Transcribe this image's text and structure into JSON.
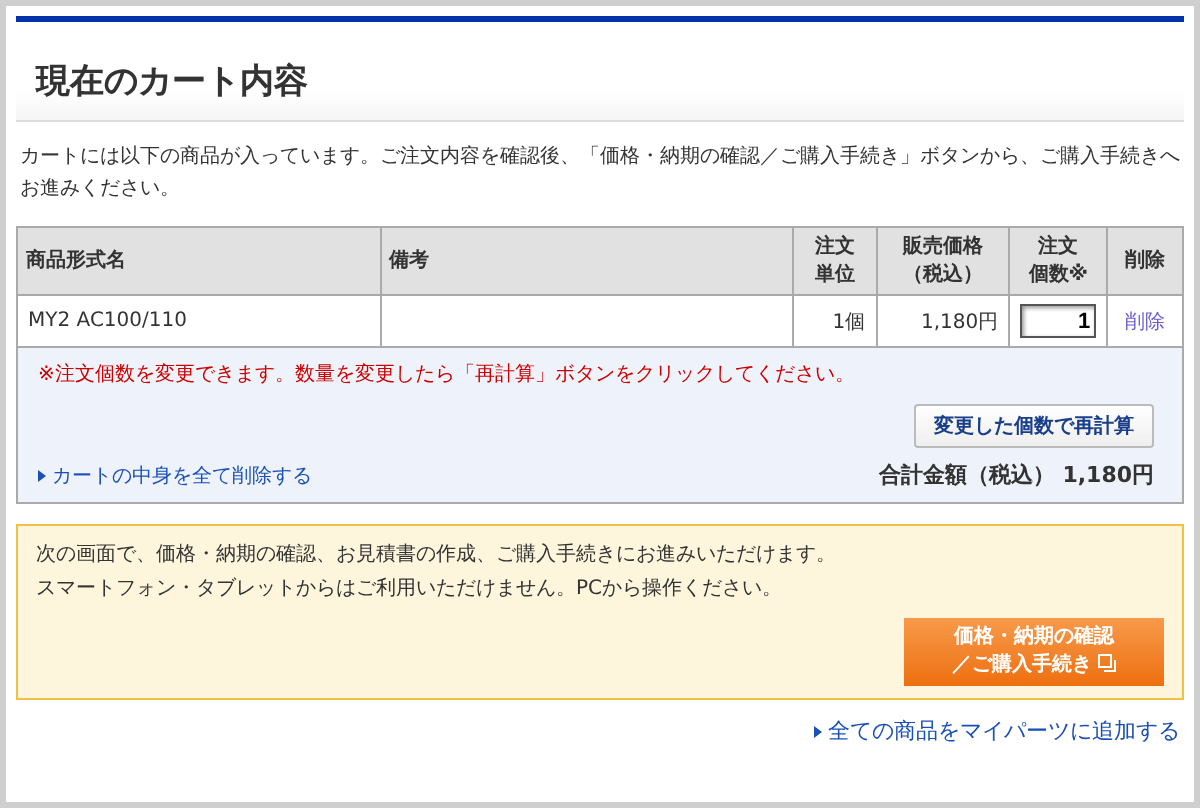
{
  "page": {
    "title": "現在のカート内容",
    "intro": "カートには以下の商品が入っています。ご注文内容を確認後、「価格・納期の確認／ご購入手続き」ボタンから、ご購入手続きへお進みください。"
  },
  "table": {
    "columns": [
      [
        "商品形式名"
      ],
      [
        "備考"
      ],
      [
        "注文",
        "単位"
      ],
      [
        "販売価格",
        "（税込）"
      ],
      [
        "注文",
        "個数※"
      ],
      [
        "削除"
      ]
    ],
    "rows": [
      {
        "model": "MY2 AC100/110",
        "unit": "1個",
        "price": "1,180円",
        "quantity": "1",
        "delete": "削除"
      }
    ]
  },
  "cart_footer": {
    "notice": "※注文個数を変更できます。数量を変更したら「再計算」ボタンをクリックしてください。",
    "recalc_button": "変更した個数で再計算",
    "clear_link": "カートの中身を全て削除する",
    "total": "合計金額（税込） 1,180円"
  },
  "checkout": {
    "lines": [
      "次の画面で、価格・納期の確認、お見積書の作成、ご購入手続きにお進みいただけます。",
      "スマートフォン・タブレットからはご利用いただけません。PCから操作ください。"
    ],
    "button": [
      "価格・納期の確認",
      "／ご購入手続き"
    ]
  },
  "bottom_link": "全ての商品をマイパーツに追加する"
}
